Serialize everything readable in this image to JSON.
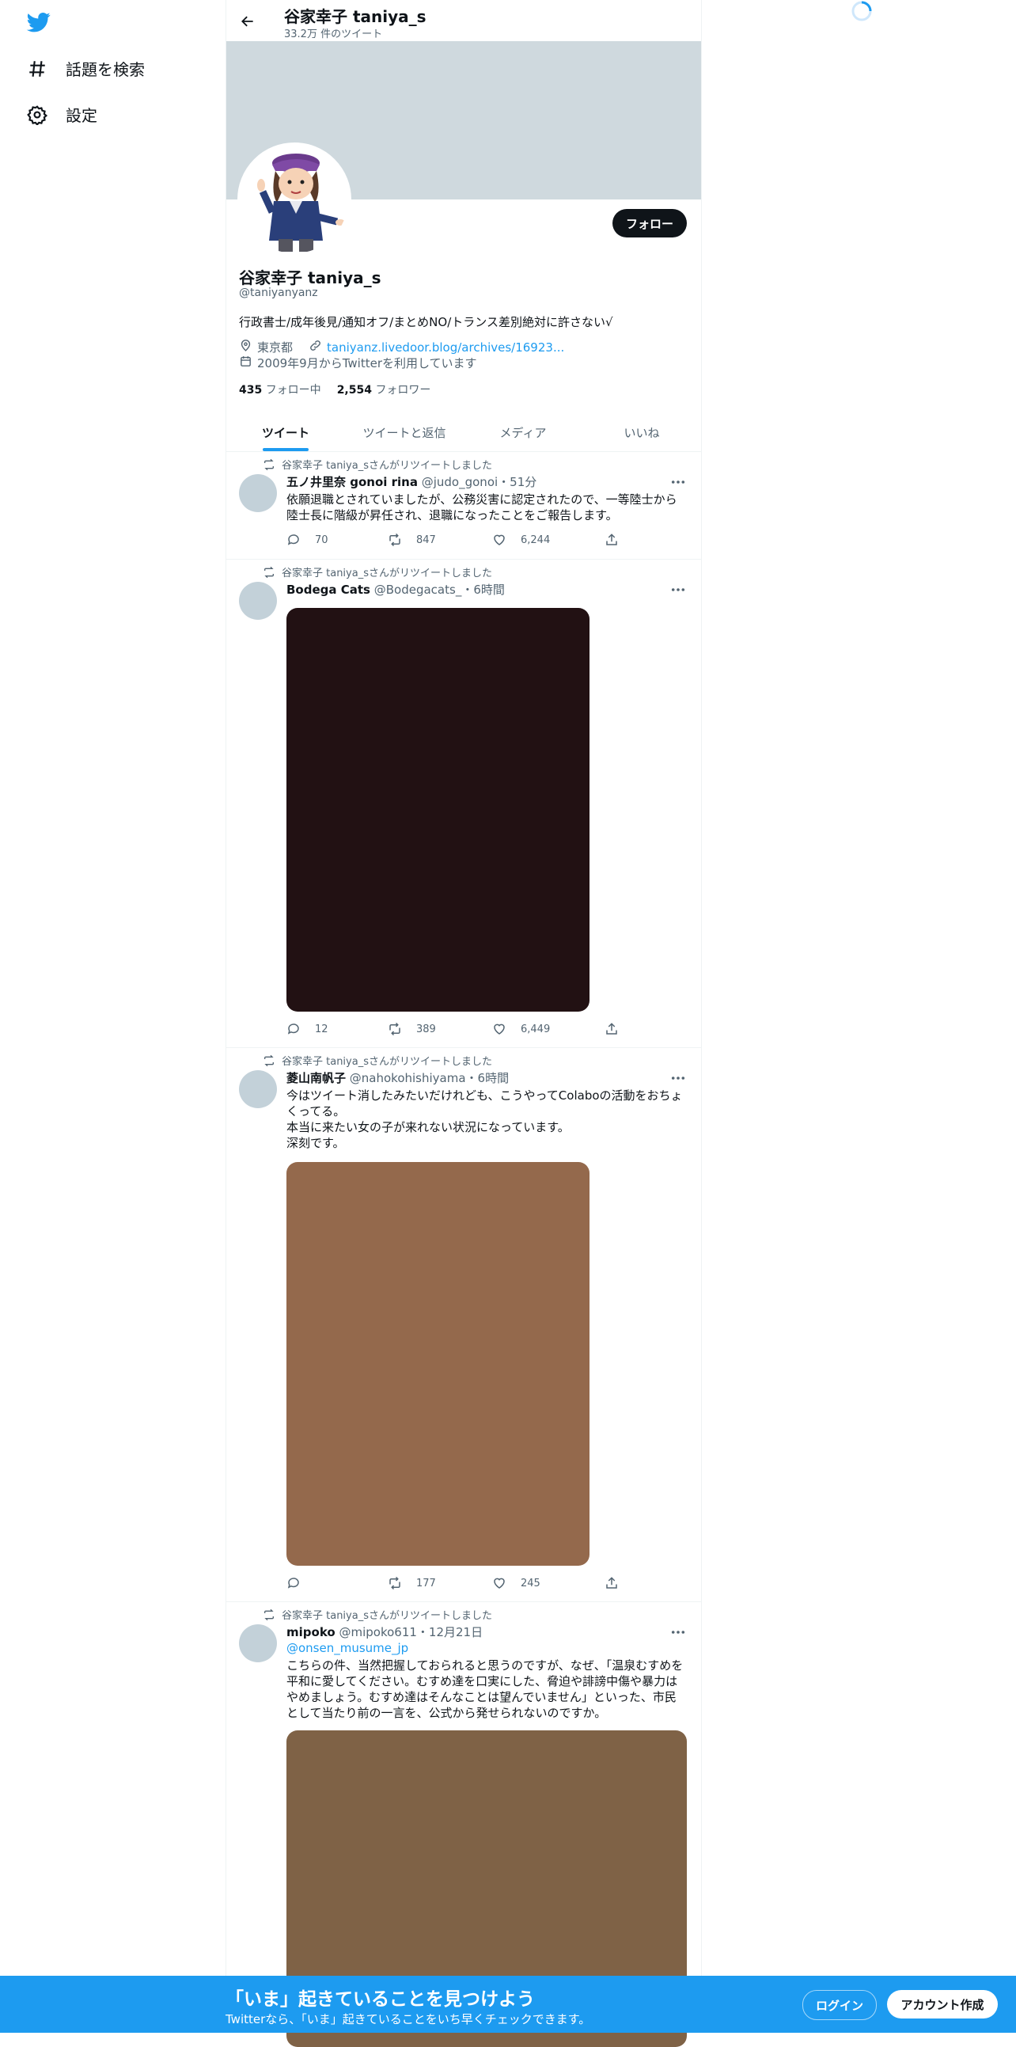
{
  "nav": {
    "logo": "twitter-bird-icon",
    "items": [
      {
        "label": "話題を検索",
        "icon": "hashtag-icon"
      },
      {
        "label": "設定",
        "icon": "gear-icon"
      }
    ]
  },
  "header": {
    "title": "谷家幸子 taniya_s",
    "tweet_count": "33.2万 件のツイート"
  },
  "profile": {
    "name": "谷家幸子 taniya_s",
    "handle": "@taniyanyanz",
    "bio": "行政書士/成年後見/通知オフ/まとめNO/トランス差別絶対に許さない√",
    "location": "東京都",
    "link": "taniyanz.livedoor.blog/archives/16923...",
    "joined": "2009年9月からTwitterを利用しています",
    "following_count": "435",
    "following_label": "フォロー中",
    "followers_count": "2,554",
    "followers_label": "フォロワー",
    "follow_button": "フォロー"
  },
  "tabs": [
    {
      "label": "ツイート",
      "active": true
    },
    {
      "label": "ツイートと返信",
      "active": false
    },
    {
      "label": "メディア",
      "active": false
    },
    {
      "label": "いいね",
      "active": false
    }
  ],
  "tweets": [
    {
      "retweeted_by": "谷家幸子 taniya_sさんがリツイートしました",
      "name": "五ノ井里奈 gonoi rina",
      "handle": "@judo_gonoi",
      "time": "・51分",
      "reply_to": "",
      "text": "依願退職とされていましたが、公務災害に認定されたので、一等陸士から陸士長に階級が昇任され、退職になったことをご報告します。",
      "replies": "70",
      "retweets": "847",
      "likes": "6,244",
      "media_color": ""
    },
    {
      "retweeted_by": "谷家幸子 taniya_sさんがリツイートしました",
      "name": "Bodega Cats",
      "handle": "@Bodegacats_",
      "time": "・6時間",
      "reply_to": "",
      "text": "",
      "replies": "12",
      "retweets": "389",
      "likes": "6,449",
      "media_color": "#221113"
    },
    {
      "retweeted_by": "谷家幸子 taniya_sさんがリツイートしました",
      "name": "菱山南帆子",
      "handle": "@nahokohishiyama",
      "time": "・6時間",
      "reply_to": "",
      "text": "今はツイート消したみたいだけれども、こうやってColaboの活動をおちょくってる。\n本当に来たい女の子が来れない状況になっています。\n深刻です。",
      "replies": "",
      "retweets": "177",
      "likes": "245",
      "media_color": "#94694c"
    },
    {
      "retweeted_by": "谷家幸子 taniya_sさんがリツイートしました",
      "name": "mipoko",
      "handle": "@mipoko611",
      "time": "・12月21日",
      "reply_to": "@onsen_musume_jp",
      "text": "こちらの件、当然把握しておられると思うのですが、なぜ、「温泉むすめを平和に愛してください。むすめ達を口実にした、脅迫や誹謗中傷や暴力はやめましょう。むすめ達はそんなことは望んでいません」といった、市民として当たり前の一言を、公式から発せられないのですか。",
      "replies": "",
      "retweets": "",
      "likes": "",
      "media_color": "#7f6246"
    }
  ],
  "bottom_bar": {
    "title": "「いま」起きていることを見つけよう",
    "subtitle": "Twitterなら、「いま」起きていることをいち早くチェックできます。",
    "login": "ログイン",
    "signup": "アカウント作成"
  },
  "colors": {
    "accent": "#1d9bf0",
    "text": "#0f1419",
    "secondary": "#536471",
    "banner": "#cfd9de"
  }
}
